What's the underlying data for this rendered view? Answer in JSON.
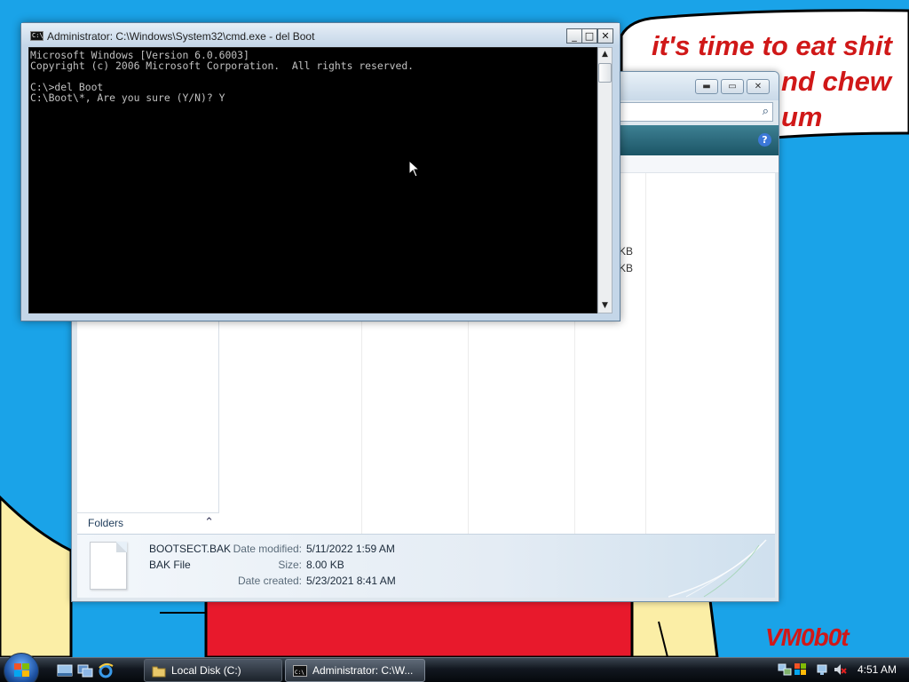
{
  "desktop": {
    "speech_lines": [
      "it's time to eat shit",
      "nd chew",
      "um"
    ],
    "watermark": "VM0b0t"
  },
  "explorer": {
    "title": "Local Disk (C:)",
    "sizes": [
      "KB",
      "KB"
    ],
    "folders_label": "Folders",
    "details": {
      "file_name": "BOOTSECT.BAK",
      "file_type": "BAK File",
      "date_modified_label": "Date modified:",
      "date_modified": "5/11/2022 1:59 AM",
      "size_label": "Size:",
      "size": "8.00 KB",
      "date_created_label": "Date created:",
      "date_created": "5/23/2021 8:41 AM"
    }
  },
  "cmd": {
    "title": "Administrator: C:\\Windows\\System32\\cmd.exe - del  Boot",
    "icon_text": "C:\\",
    "console_text": "Microsoft Windows [Version 6.0.6003]\nCopyright (c) 2006 Microsoft Corporation.  All rights reserved.\n\nC:\\>del Boot\nC:\\Boot\\*, Are you sure (Y/N)? Y",
    "minimize_glyph": "_",
    "maximize_glyph": "□",
    "close_glyph": "✕"
  },
  "taskbar": {
    "tasks": [
      {
        "label": "Local Disk (C:)",
        "icon": "folder-icon"
      },
      {
        "label": "Administrator: C:\\W...",
        "icon": "cmd-icon"
      }
    ],
    "clock": "4:51 AM"
  }
}
